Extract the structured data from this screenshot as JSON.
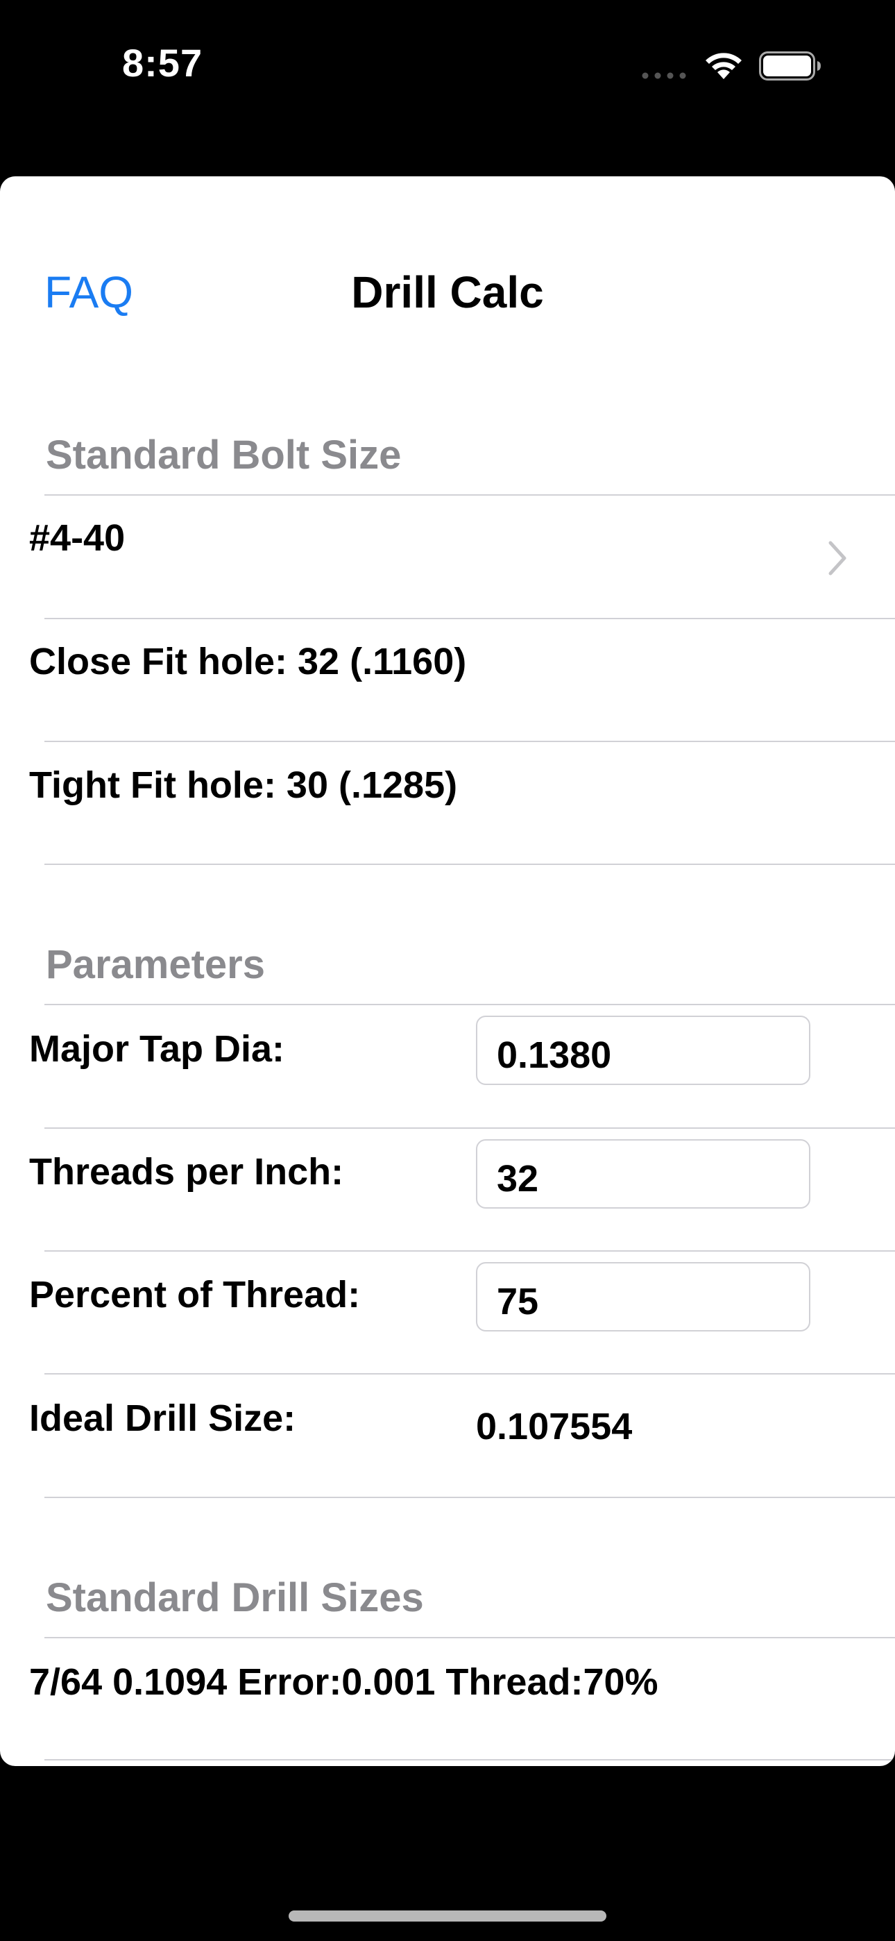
{
  "status_bar": {
    "time": "8:57"
  },
  "nav": {
    "faq_label": "FAQ",
    "title": "Drill Calc"
  },
  "standard_bolt_size": {
    "header": "Standard Bolt Size",
    "selected_bolt": "#4-40",
    "close_fit": "Close Fit hole: 32 (.1160)",
    "tight_fit": "Tight Fit hole: 30 (.1285)"
  },
  "parameters": {
    "header": "Parameters",
    "major_tap_dia_label": "Major Tap Dia:",
    "major_tap_dia_value": "0.1380",
    "threads_per_inch_label": "Threads per Inch:",
    "threads_per_inch_value": "32",
    "percent_thread_label": "Percent of Thread:",
    "percent_thread_value": "75",
    "ideal_drill_label": "Ideal Drill Size:",
    "ideal_drill_value": "0.107554"
  },
  "standard_drill_sizes": {
    "header": "Standard Drill Sizes",
    "results": [
      "7/64 0.1094 Error:0.001 Thread:70%"
    ]
  },
  "colors": {
    "accent": "#1a7cf2",
    "section_header": "#8a8a8e",
    "separator": "#d1d1d6"
  },
  "icons": [
    "wifi-icon",
    "battery-icon",
    "chevron-right-icon"
  ]
}
